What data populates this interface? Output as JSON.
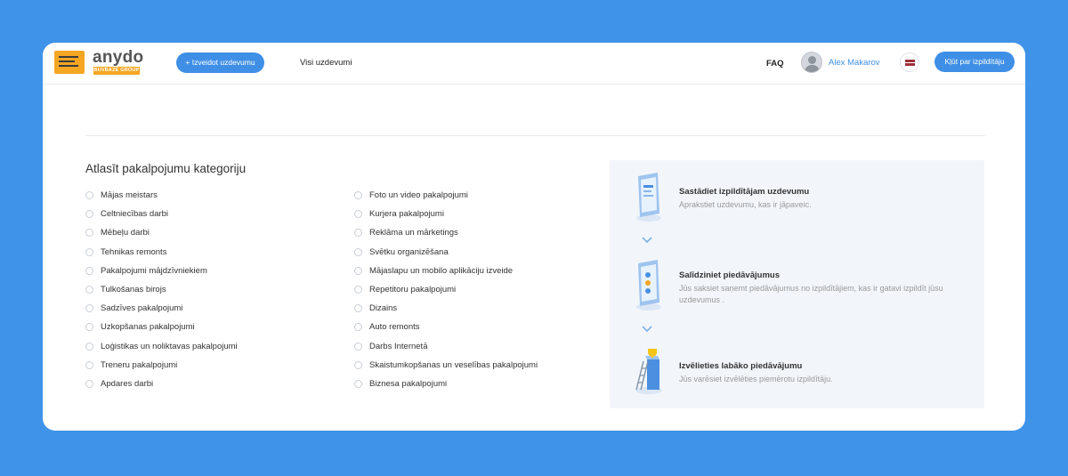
{
  "header": {
    "logo_word": "anydo",
    "logo_sub": "BUVBAZE GROUP",
    "create_task_label": "+ Izveidot uzdevumu",
    "all_tasks_label": "Visi uzdevumi",
    "faq_label": "FAQ",
    "user_name": "Alex Makarov",
    "language": "lv",
    "become_provider_label": "Kļūt par izpildītāju"
  },
  "categories": {
    "title": "Atlasīt pakalpojumu kategoriju",
    "left": [
      "Mājas meistars",
      "Celtniecības darbi",
      "Mēbeļu darbi",
      "Tehnikas remonts",
      "Pakalpojumi mājdzīvniekiem",
      "Tulkošanas birojs",
      "Sadzīves pakalpojumi",
      "Uzkopšanas pakalpojumi",
      "Loģistikas un noliktavas pakalpojumi",
      "Treneru pakalpojumi",
      "Apdares darbi"
    ],
    "right": [
      "Foto un video pakalpojumi",
      "Kurjera pakalpojumi",
      "Reklāma un mārketings",
      "Svētku organizēšana",
      "Mājaslapu un mobilo aplikāciju izveide",
      "Repetitoru pakalpojumi",
      "Dizains",
      "Auto remonts",
      "Darbs Internetā",
      "Skaistumkopšanas un veselības pakalpojumi",
      "Biznesa pakalpojumi"
    ]
  },
  "steps": [
    {
      "title": "Sastādiet izpildītājam uzdevumu",
      "desc": "Aprakstiet uzdevumu, kas ir jāpaveic."
    },
    {
      "title": "Salīdziniet piedāvājumus",
      "desc": "Jūs saksiet saņemt piedāvājumus no izpildītājiem, kas ir gatavi izpildīt jūsu uzdevumus ."
    },
    {
      "title": "Izvēlieties labāko piedāvājumu",
      "desc": "Jūs varēsiet izvēlēties piemērotu izpildītāju."
    }
  ],
  "colors": {
    "background": "#3f93e8",
    "accent": "#3f8fe6",
    "logo_orange": "#f5a623",
    "panel": "#f2f6fb"
  }
}
